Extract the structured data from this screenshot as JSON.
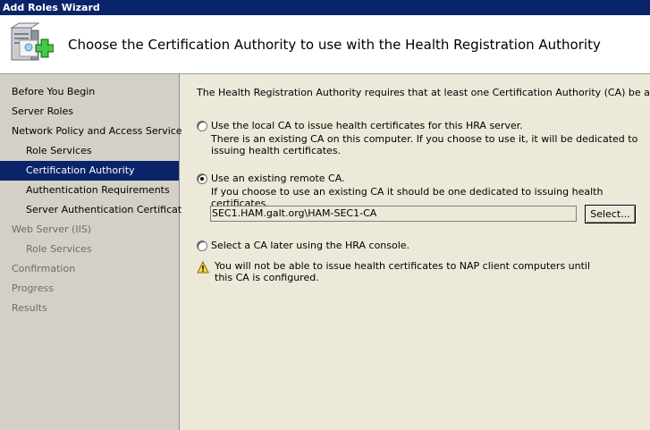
{
  "window": {
    "title": "Add Roles Wizard"
  },
  "header": {
    "title": "Choose the Certification Authority to use with the Health Registration Authority",
    "icon": "server-add-icon"
  },
  "nav": {
    "items": [
      {
        "label": "Before You Begin"
      },
      {
        "label": "Server Roles"
      },
      {
        "label": "Network Policy and Access Services"
      },
      {
        "label": "Role Services"
      },
      {
        "label": "Certification Authority"
      },
      {
        "label": "Authentication Requirements"
      },
      {
        "label": "Server Authentication Certificate"
      },
      {
        "label": "Web Server (IIS)"
      },
      {
        "label": "Role Services"
      },
      {
        "label": "Confirmation"
      },
      {
        "label": "Progress"
      },
      {
        "label": "Results"
      }
    ],
    "active_index": 4
  },
  "content": {
    "intro": "The Health Registration Authority requires that at least one Certification Authority (CA) be associated wit",
    "options": [
      {
        "label": "Use the local CA to issue health certificates for this HRA server.",
        "description": "There is an existing CA on this computer. If you choose to use it, it will be dedicated to issuing health certificates.",
        "selected": false
      },
      {
        "label": "Use an existing remote CA.",
        "description": "If you choose to use an existing CA it should be one dedicated to issuing health certificates.",
        "selected": true
      },
      {
        "label": "Select a CA later using the HRA console.",
        "selected": false
      }
    ],
    "ca_value": "SEC1.HAM.galt.org\\HAM-SEC1-CA",
    "select_button": "Select...",
    "warning": "You will not be able to issue health certificates to NAP client computers until this CA is configured.",
    "warning_icon": "warning-icon"
  },
  "colors": {
    "titlebar": "#0a246a",
    "nav_bg": "#d4d0c8",
    "content_bg": "#ece9d8",
    "selected": "#0a246a"
  }
}
